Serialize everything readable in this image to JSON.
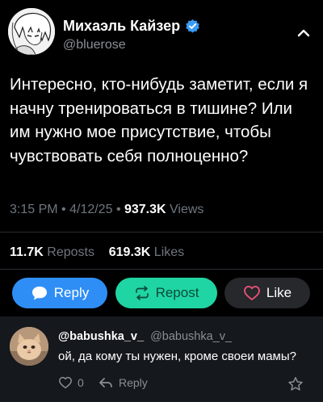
{
  "author": {
    "display_name": "Михаэль Кайзер",
    "handle": "@bluerose",
    "avatar_icon": "anime-portrait-avatar",
    "verified_icon": "verified-badge-icon"
  },
  "post": {
    "text": "Интересно, кто-нибудь заметит, если я начну тренироваться в тишине? Или им нужно мое присутствие, чтобы чувствовать себя полноценно?",
    "time": "3:15 PM",
    "date": "4/12/25",
    "views_count": "937.3K",
    "views_label": "Views"
  },
  "stats": {
    "reposts_count": "11.7K",
    "reposts_label": "Reposts",
    "likes_count": "619.3K",
    "likes_label": "Likes"
  },
  "actions": {
    "reply_label": "Reply",
    "repost_label": "Repost",
    "like_label": "Like"
  },
  "reply": {
    "name": "@babushka_v_",
    "handle": "@babushka_v_",
    "text": "ой, да кому ты нужен, кроме своеи мамы?",
    "like_count": "0",
    "reply_label": "Reply",
    "avatar_icon": "cat-photo-avatar"
  },
  "colors": {
    "background": "#000000",
    "reply_button": "#2f8ef5",
    "repost_button": "#1fd5a3",
    "like_button": "#26282b",
    "like_heart": "#f0517a",
    "verified": "#3a9bf5"
  }
}
